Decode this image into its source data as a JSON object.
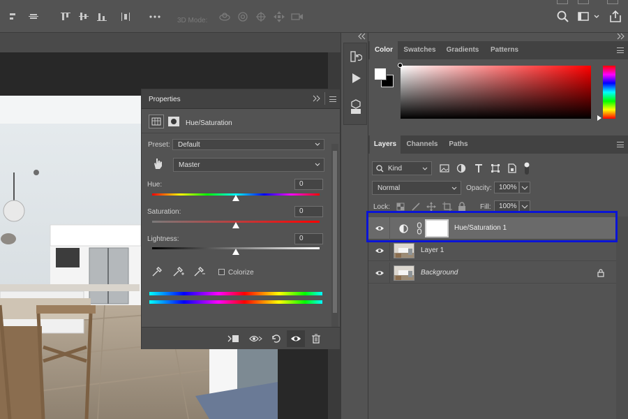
{
  "toolbar": {
    "label_3d": "3D Mode:",
    "icons": [
      "align-left-icon",
      "align-center-icon",
      "align-top-icon",
      "align-middle-icon",
      "align-bottom-icon",
      "distribute-icon",
      "more-icon",
      "orbit-icon",
      "roll-icon",
      "pan-icon",
      "slide-icon",
      "camera-icon",
      "search-icon",
      "workspace-icon",
      "share-icon"
    ]
  },
  "properties": {
    "title": "Properties",
    "adjustment_name": "Hue/Saturation",
    "preset_label": "Preset:",
    "preset_value": "Default",
    "channel_value": "Master",
    "hue": {
      "label": "Hue:",
      "value": "0",
      "position": 0.5
    },
    "saturation": {
      "label": "Saturation:",
      "value": "0",
      "position": 0.5
    },
    "lightness": {
      "label": "Lightness:",
      "value": "0",
      "position": 0.5
    },
    "colorize_label": "Colorize",
    "colorize_checked": false
  },
  "color_panel": {
    "tabs": [
      "Color",
      "Swatches",
      "Gradients",
      "Patterns"
    ],
    "active_tab": "Color",
    "hue_hex": "#ff0000"
  },
  "layers_panel": {
    "tabs": [
      "Layers",
      "Channels",
      "Paths"
    ],
    "active_tab": "Layers",
    "filter_kind": "Kind",
    "blend_mode": "Normal",
    "opacity_label": "Opacity:",
    "opacity_value": "100%",
    "lock_label": "Lock:",
    "fill_label": "Fill:",
    "fill_value": "100%",
    "layers": [
      {
        "name": "Hue/Saturation 1",
        "type": "adjustment",
        "selected": true
      },
      {
        "name": "Layer 1",
        "type": "pixel",
        "selected": false
      },
      {
        "name": "Background",
        "type": "background",
        "selected": false,
        "locked": true
      }
    ]
  },
  "colors": {
    "highlight": "#0a14d6",
    "panel_bg": "#535353",
    "tab_bg": "#424242"
  }
}
